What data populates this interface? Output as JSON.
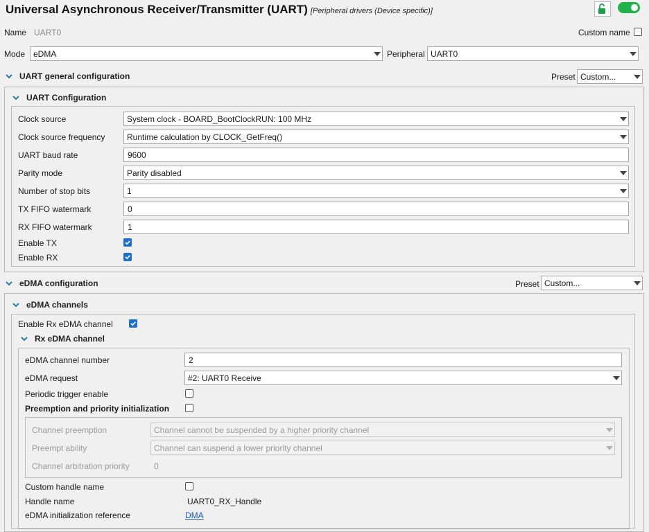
{
  "header": {
    "title": "Universal Asynchronous Receiver/Transmitter (UART)",
    "subtitle": "[Peripheral drivers (Device specific)]"
  },
  "name_row": {
    "label": "Name",
    "value": "UART0",
    "custom_name_label": "Custom name"
  },
  "mode_row": {
    "mode_label": "Mode",
    "mode_value": "eDMA",
    "peripheral_label": "Peripheral",
    "peripheral_value": "UART0"
  },
  "uart_general": {
    "title": "UART general configuration",
    "preset_label": "Preset",
    "preset_value": "Custom...",
    "uart_config": {
      "title": "UART Configuration",
      "clock_source_label": "Clock source",
      "clock_source_value": "System clock - BOARD_BootClockRUN: 100 MHz",
      "clock_freq_label": "Clock source frequency",
      "clock_freq_value": "Runtime calculation by CLOCK_GetFreq()",
      "baud_label": "UART baud rate",
      "baud_value": "9600",
      "parity_label": "Parity mode",
      "parity_value": "Parity disabled",
      "stop_bits_label": "Number of stop bits",
      "stop_bits_value": "1",
      "tx_fifo_label": "TX FIFO watermark",
      "tx_fifo_value": "0",
      "rx_fifo_label": "RX FIFO watermark",
      "rx_fifo_value": "1",
      "enable_tx_label": "Enable TX",
      "enable_tx": true,
      "enable_rx_label": "Enable RX",
      "enable_rx": true
    }
  },
  "edma_config": {
    "title": "eDMA configuration",
    "preset_label": "Preset",
    "preset_value": "Custom...",
    "channels": {
      "title": "eDMA channels",
      "enable_rx_label": "Enable Rx eDMA channel",
      "enable_rx": true,
      "rx_channel": {
        "title": "Rx eDMA channel",
        "channel_number_label": "eDMA channel number",
        "channel_number_value": "2",
        "request_label": "eDMA request",
        "request_value": "#2: UART0 Receive",
        "periodic_label": "Periodic trigger enable",
        "periodic": false,
        "preemption_label": "Preemption and priority initialization",
        "preemption": false,
        "channel_preemption_label": "Channel preemption",
        "channel_preemption_value": "Channel  cannot be suspended by a higher priority channel",
        "preempt_ability_label": "Preempt ability",
        "preempt_ability_value": "Channel  can suspend a lower priority channel",
        "arbitration_label": "Channel arbitration priority",
        "arbitration_value": "0",
        "custom_handle_label": "Custom handle name",
        "custom_handle": false,
        "handle_name_label": "Handle name",
        "handle_name_value": "UART0_RX_Handle",
        "init_ref_label": "eDMA initialization reference",
        "init_ref_link": "DMA"
      }
    }
  },
  "colors": {
    "accent": "#1e6fc9",
    "toggle_on": "#22b24c",
    "link": "#1a5fb4",
    "lock_green": "#1f9e4a"
  },
  "icons": {
    "lock": "unlock-icon",
    "toggle": "enable-toggle-icon",
    "chevron": "chevron-down-icon",
    "check": "check-icon"
  }
}
